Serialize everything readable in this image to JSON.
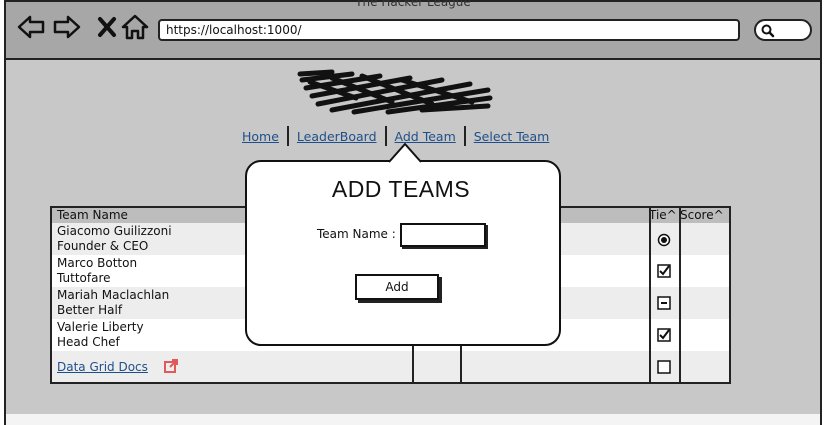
{
  "window": {
    "title": "The Hacker League"
  },
  "browser": {
    "url": "https://localhost:1000/"
  },
  "nav": {
    "items": [
      {
        "label": "Home"
      },
      {
        "label": "LeaderBoard"
      },
      {
        "label": "Add Team"
      },
      {
        "label": "Select Team"
      }
    ]
  },
  "grid": {
    "headers": {
      "team_name": "Team Name",
      "tie": "Tie^",
      "score": "Score^"
    },
    "rows": [
      {
        "line1": "Giacomo Guilizzoni",
        "line2": "Founder & CEO",
        "tie_state": "radio-selected"
      },
      {
        "line1": "Marco Botton",
        "line2": "Tuttofare",
        "tie_state": "checked"
      },
      {
        "line1": "Mariah Maclachlan",
        "line2": "Better Half",
        "tie_state": "indeterminate"
      },
      {
        "line1": "Valerie Liberty",
        "line2": "Head Chef",
        "tie_state": "checked"
      },
      {
        "line1": "",
        "line2": "",
        "tie_state": "unchecked"
      }
    ],
    "docs_link": "Data Grid Docs"
  },
  "modal": {
    "title": "ADD TEAMS",
    "field_label": "Team Name :",
    "field_value": "",
    "button_label": "Add"
  },
  "colors": {
    "chrome": "#a7a7a7",
    "page": "#c8c8c8",
    "link": "#1f4f8a",
    "external_icon": "#e05a5a"
  }
}
